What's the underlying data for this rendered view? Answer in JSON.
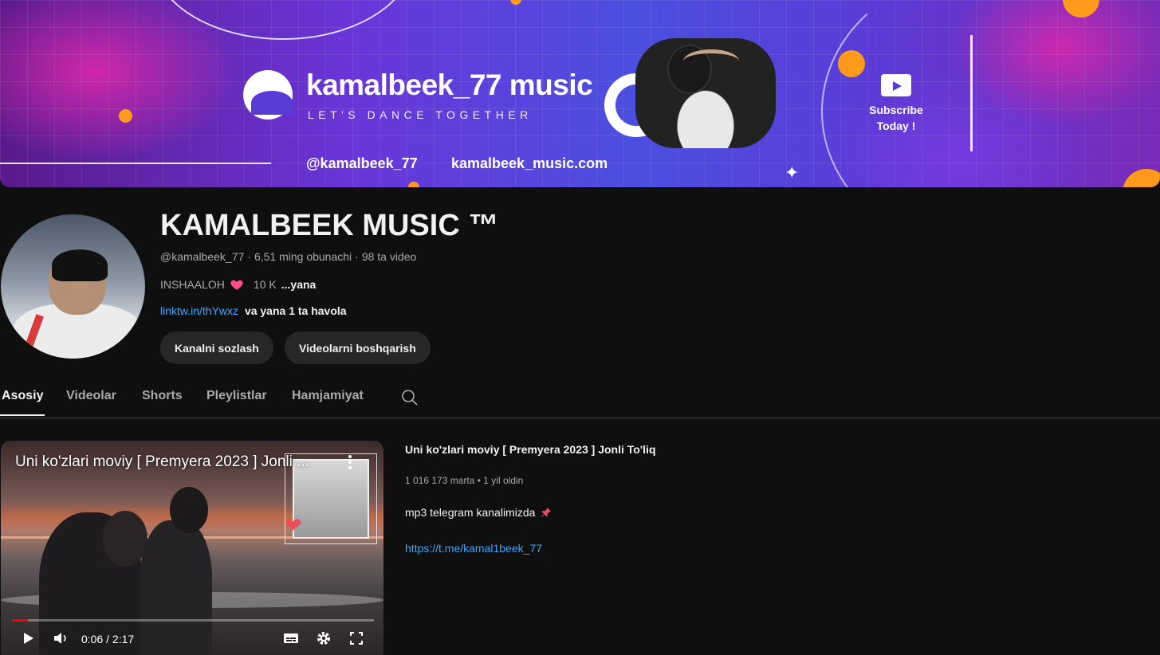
{
  "banner": {
    "title": "kamalbeek_77 music",
    "tagline": "LET'S DANCE TOGETHER",
    "handle": "@kamalbeek_77",
    "website": "kamalbeek_music.com",
    "subscribe_line1": "Subscribe",
    "subscribe_line2": "Today !"
  },
  "channel": {
    "name": "KAMALBEEK MUSIC ™",
    "handle": "@kamalbeek_77",
    "subscribers": "6,51 ming obunachi",
    "videos": "98 ta video",
    "description_text": "INSHAALOH",
    "description_suffix": "10 K",
    "description_more": "...yana",
    "link": "linktw.in/thYwxz",
    "links_more": "va yana 1 ta havola",
    "buttons": {
      "customize": "Kanalni sozlash",
      "manage_videos": "Videolarni boshqarish"
    }
  },
  "tabs": [
    {
      "label": "Asosiy",
      "active": true
    },
    {
      "label": "Videolar",
      "active": false
    },
    {
      "label": "Shorts",
      "active": false
    },
    {
      "label": "Pleylistlar",
      "active": false
    },
    {
      "label": "Hamjamiyat",
      "active": false
    }
  ],
  "featured_video": {
    "player_title": "Uni ko'zlari moviy [ Premyera 2023 ] Jonli ...",
    "title": "Uni ko'zlari moviy [ Premyera 2023 ] Jonli To'liq",
    "views": "1 016 173 marta",
    "age": "1 yil oldin",
    "description": "mp3 telegram kanalimizda",
    "link": "https://t.me/kamal1beek_77",
    "time_current": "0:06",
    "time_total": "2:17",
    "time_display": "0:06 / 2:17",
    "progress_fraction": 0.044
  },
  "colors": {
    "background": "#0f0f0f",
    "link": "#3ea6ff",
    "button": "#272727",
    "progress": "#ff0000",
    "heart": "#ff4e8a"
  },
  "icons": {
    "search": "search-icon",
    "heart": "heart-icon",
    "pin": "pin-icon",
    "kebab": "kebab-menu-icon",
    "play": "play-icon",
    "volume": "volume-icon",
    "subtitles": "subtitles-icon",
    "settings": "gear-icon",
    "fullscreen": "fullscreen-icon"
  }
}
